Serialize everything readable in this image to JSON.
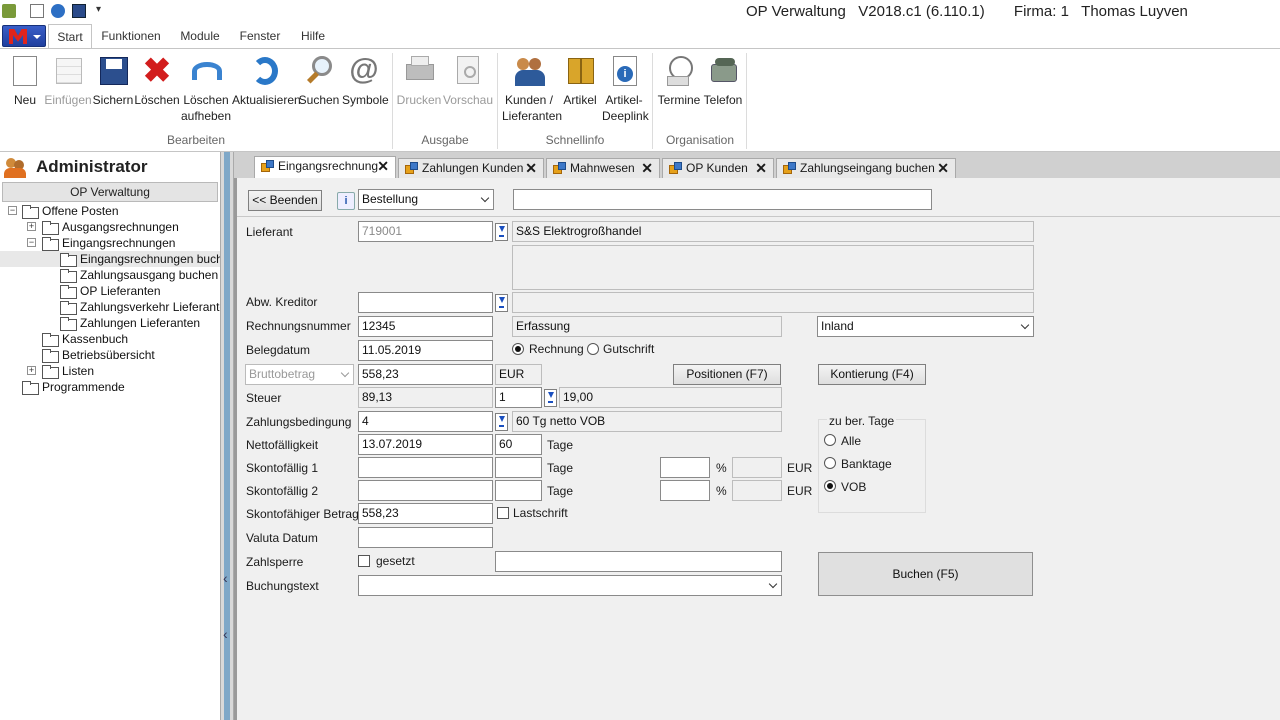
{
  "window": {
    "title": "OP Verwaltung   V2018.c1 (6.110.1)       Firma: 1   Thomas Luyven"
  },
  "menu": {
    "tabs": [
      "Start",
      "Funktionen",
      "Module",
      "Fenster",
      "Hilfe"
    ]
  },
  "ribbon": {
    "groups": [
      {
        "label": "Bearbeiten",
        "buttons": [
          "Neu",
          "Einfügen",
          "Sichern",
          "Löschen",
          "Löschen aufheben",
          "Aktualisieren",
          "Suchen",
          "Symbole"
        ]
      },
      {
        "label": "Ausgabe",
        "buttons": [
          "Drucken",
          "Vorschau"
        ]
      },
      {
        "label": "Schnellinfo",
        "buttons": [
          "Kunden / Lieferanten",
          "Artikel",
          "Artikel-Deeplink"
        ]
      },
      {
        "label": "Organisation",
        "buttons": [
          "Termine",
          "Telefon"
        ]
      }
    ],
    "b_neu": "Neu",
    "b_einfuegen": "Einfügen",
    "b_sichern": "Sichern",
    "b_loeschen": "Löschen",
    "b_loeschen_auf1": "Löschen",
    "b_loeschen_auf2": "aufheben",
    "b_aktualisieren": "Aktualisieren",
    "b_suchen": "Suchen",
    "b_symbole": "Symbole",
    "b_drucken": "Drucken",
    "b_vorschau": "Vorschau",
    "b_kunden1": "Kunden /",
    "b_kunden2": "Lieferanten",
    "b_artikel": "Artikel",
    "b_deeplink1": "Artikel-",
    "b_deeplink2": "Deeplink",
    "b_termine": "Termine",
    "b_telefon": "Telefon",
    "g_bearbeiten": "Bearbeiten",
    "g_ausgabe": "Ausgabe",
    "g_schnellinfo": "Schnellinfo",
    "g_organisation": "Organisation"
  },
  "sidebar": {
    "user": "Administrator",
    "module": "OP Verwaltung",
    "tree": [
      "Offene Posten",
      "Ausgangsrechnungen",
      "Eingangsrechnungen",
      "Eingangsrechnungen buchen",
      "Zahlungsausgang buchen",
      "OP Lieferanten",
      "Zahlungsverkehr Lieferanten",
      "Zahlungen Lieferanten",
      "Kassenbuch",
      "Betriebsübersicht",
      "Listen",
      "Programmende"
    ]
  },
  "doc_tabs": [
    "Eingangsrechnung",
    "Zahlungen Kunden",
    "Mahnwesen",
    "OP Kunden",
    "Zahlungseingang buchen"
  ],
  "form": {
    "beenden": "<< Beenden",
    "mode_select": "Bestellung",
    "search_value": "",
    "labels": {
      "lieferant": "Lieferant",
      "abw_kreditor": "Abw. Kreditor",
      "rechnungsnummer": "Rechnungsnummer",
      "belegdatum": "Belegdatum",
      "steuer": "Steuer",
      "zahlungsbedingung": "Zahlungsbedingung",
      "nettofaelligkeit": "Nettofälligkeit",
      "skonto1": "Skontofällig 1",
      "skonto2": "Skontofällig 2",
      "skonto_betrag": "Skontofähiger Betrag",
      "valuta": "Valuta Datum",
      "zahlsperre": "Zahlsperre",
      "buchungstext": "Buchungstext",
      "tage": "Tage",
      "percent": "%",
      "eur": "EUR",
      "gesetzt": "gesetzt",
      "lastschrift": "Lastschrift",
      "rechnung": "Rechnung",
      "gutschrift": "Gutschrift"
    },
    "lieferant_nr": "719001",
    "lieferant_name": "S&S Elektrogroßhandel",
    "rechnungsnummer": "12345",
    "erfassung": "Erfassung",
    "region": "Inland",
    "belegdatum": "11.05.2019",
    "betrag_type": "Bruttobetrag",
    "betrag": "558,23",
    "currency": "EUR",
    "positionen_btn": "Positionen (F7)",
    "kontierung_btn": "Kontierung (F4)",
    "steuer_betrag": "89,13",
    "steuer_code": "1",
    "steuer_satz": "19,00",
    "zahlungsbedingung": "4",
    "zahlungsbedingung_text": "60 Tg netto VOB",
    "nettofaelligkeit": "13.07.2019",
    "netto_tage": "60",
    "skonto_betrag": "558,23",
    "tage_group": {
      "title": "zu ber. Tage",
      "options": [
        "Alle",
        "Banktage",
        "VOB"
      ],
      "selected": "VOB"
    },
    "buchen_btn": "Buchen (F5)"
  }
}
